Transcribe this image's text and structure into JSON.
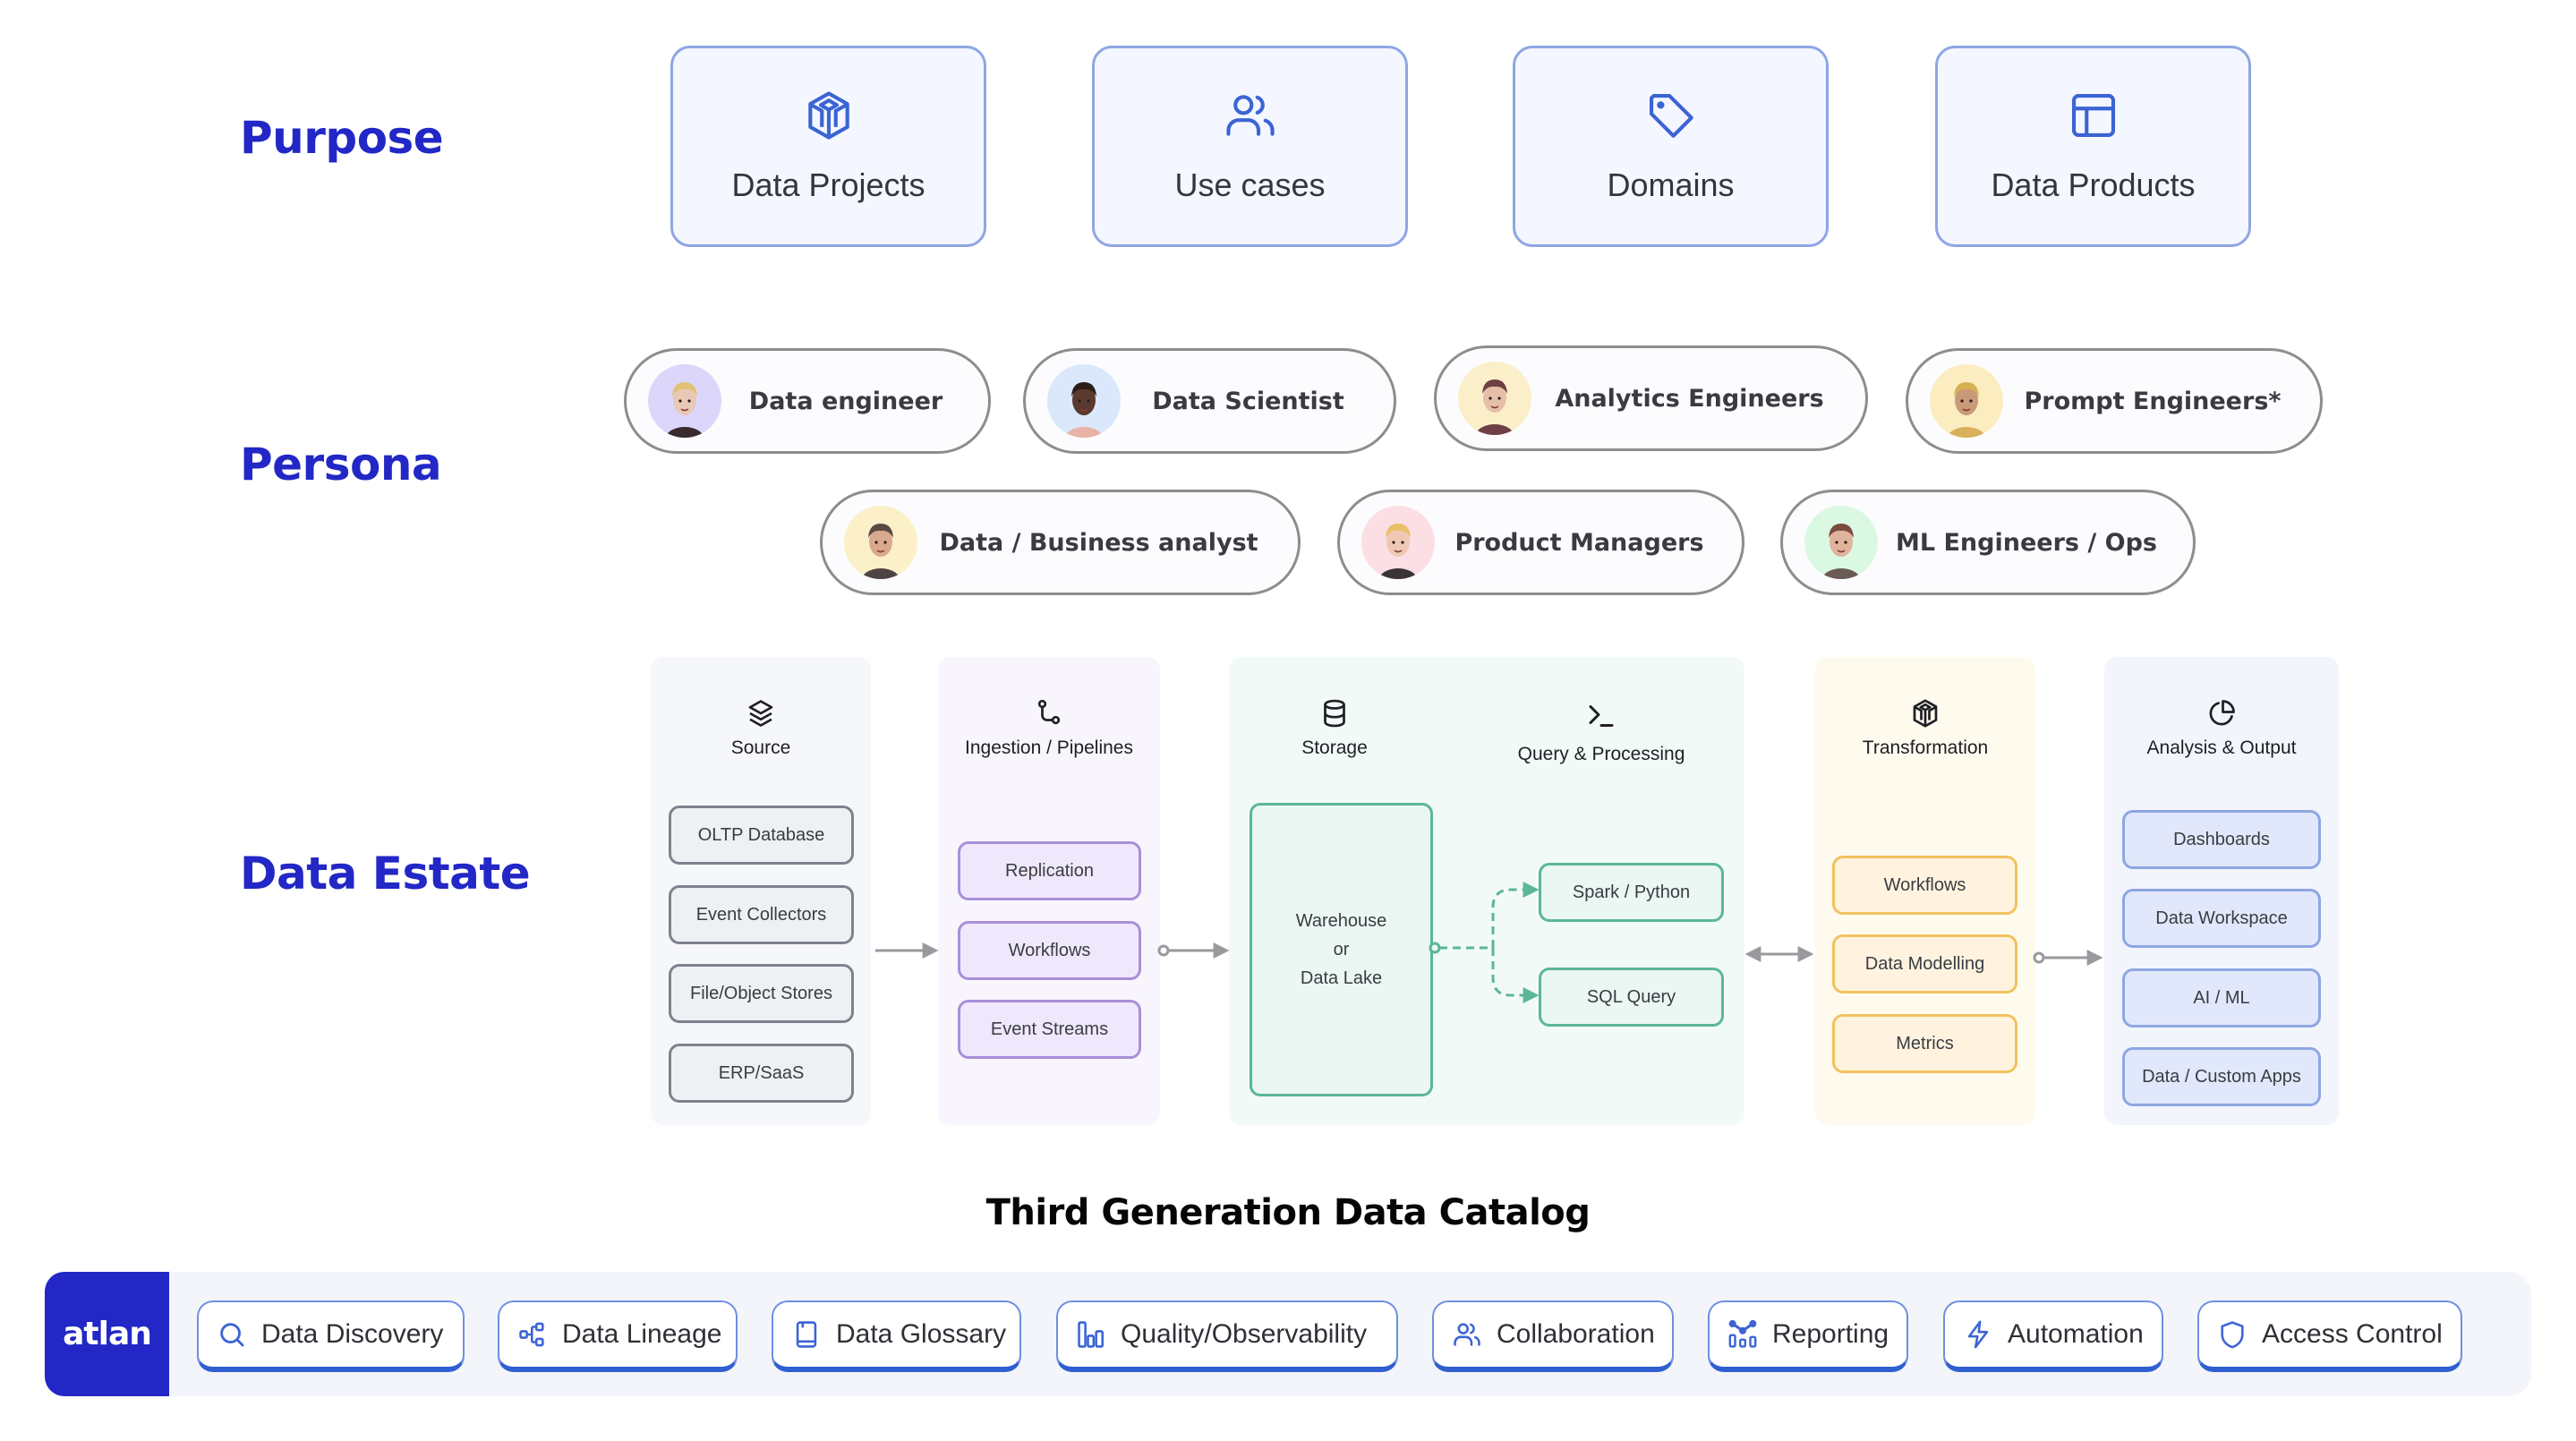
{
  "sections": {
    "purpose": "Purpose",
    "persona": "Persona",
    "data_estate": "Data Estate"
  },
  "purpose_cards": [
    {
      "label": "Data Projects",
      "icon": "cube-icon"
    },
    {
      "label": "Use cases",
      "icon": "users-icon"
    },
    {
      "label": "Domains",
      "icon": "tag-icon"
    },
    {
      "label": "Data Products",
      "icon": "layout-icon"
    }
  ],
  "personas": [
    {
      "label": "Data engineer",
      "avatar_bg": "#dcd6fb"
    },
    {
      "label": "Data Scientist",
      "avatar_bg": "#dbe8fb"
    },
    {
      "label": "Analytics Engineers",
      "avatar_bg": "#fbefc9"
    },
    {
      "label": "Prompt Engineers*",
      "avatar_bg": "#fbedc0"
    },
    {
      "label": "Data / Business analyst",
      "avatar_bg": "#fbf0c8"
    },
    {
      "label": "Product Managers",
      "avatar_bg": "#fbdfe5"
    },
    {
      "label": "ML Engineers / Ops",
      "avatar_bg": "#dbf8e3"
    }
  ],
  "data_estate": {
    "columns": {
      "source": {
        "title": "Source",
        "icon": "layers-icon",
        "items": [
          "OLTP Database",
          "Event Collectors",
          "File/Object Stores",
          "ERP/SaaS"
        ]
      },
      "ingestion": {
        "title": "Ingestion / Pipelines",
        "icon": "pipeline-icon",
        "items": [
          "Replication",
          "Workflows",
          "Event Streams"
        ]
      },
      "storage": {
        "title": "Storage",
        "icon": "database-icon",
        "items": [
          "Warehouse",
          "or",
          "Data Lake"
        ]
      },
      "query": {
        "title": "Query & Processing",
        "icon": "terminal-icon",
        "items": [
          "Spark / Python",
          "SQL Query"
        ]
      },
      "transformation": {
        "title": "Transformation",
        "icon": "cube-icon",
        "items": [
          "Workflows",
          "Data Modelling",
          "Metrics"
        ]
      },
      "analysis": {
        "title": "Analysis & Output",
        "icon": "pie-chart-icon",
        "items": [
          "Dashboards",
          "Data Workspace",
          "AI / ML",
          "Data / Custom Apps"
        ]
      }
    }
  },
  "catalog": {
    "title": "Third Generation Data Catalog",
    "logo": "atlan",
    "features": [
      {
        "label": "Data Discovery",
        "icon": "search-icon"
      },
      {
        "label": "Data Lineage",
        "icon": "lineage-icon"
      },
      {
        "label": "Data Glossary",
        "icon": "book-icon"
      },
      {
        "label": "Quality/Observability",
        "icon": "bar-chart-icon"
      },
      {
        "label": "Collaboration",
        "icon": "users-icon"
      },
      {
        "label": "Reporting",
        "icon": "reporting-icon"
      },
      {
        "label": "Automation",
        "icon": "lightning-icon"
      },
      {
        "label": "Access Control",
        "icon": "shield-icon"
      }
    ]
  },
  "colors": {
    "brand": "#2227c6",
    "accent_blue": "#3b64d4",
    "source": "#7f828c",
    "ingestion": "#a88fd9",
    "storage": "#5bb795",
    "transformation": "#f2c25f",
    "analysis": "#8ea6e3"
  }
}
